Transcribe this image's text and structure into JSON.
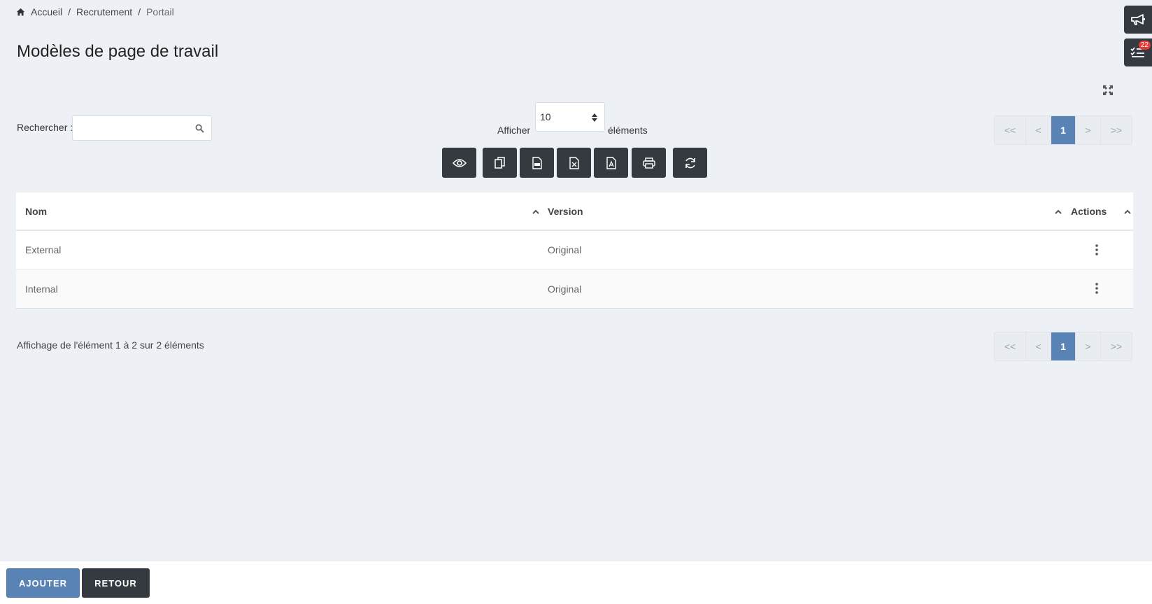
{
  "breadcrumb": {
    "home": "Accueil",
    "sep1": "/",
    "section": "Recrutement",
    "sep2": "/",
    "current": "Portail"
  },
  "page": {
    "title": "Modèles de page de travail"
  },
  "notifications": {
    "task_count": "22"
  },
  "search": {
    "label": "Rechercher :",
    "value": "",
    "placeholder": ""
  },
  "page_length": {
    "prefix": "Afficher",
    "value": "10",
    "suffix": "éléments"
  },
  "toolbar": {
    "buttons": [
      "eye-icon",
      "copy-icon",
      "csv-file-icon",
      "excel-file-icon",
      "pdf-file-icon",
      "print-icon",
      "refresh-icon"
    ]
  },
  "pagination": {
    "first": "<<",
    "prev": "<",
    "current": "1",
    "next": ">",
    "last": ">>"
  },
  "table": {
    "columns": {
      "name": "Nom",
      "version": "Version",
      "actions": "Actions"
    },
    "rows": [
      {
        "name": "External",
        "version": "Original"
      },
      {
        "name": "Internal",
        "version": "Original"
      }
    ]
  },
  "info": {
    "text": "Affichage de l'élément 1 à 2 sur 2 éléments"
  },
  "footer": {
    "add_label": "AJOUTER",
    "back_label": "RETOUR"
  },
  "colors": {
    "primary": "#5a83b5",
    "dark": "#343a40",
    "background": "#edf1f6",
    "badge": "#e53935"
  }
}
